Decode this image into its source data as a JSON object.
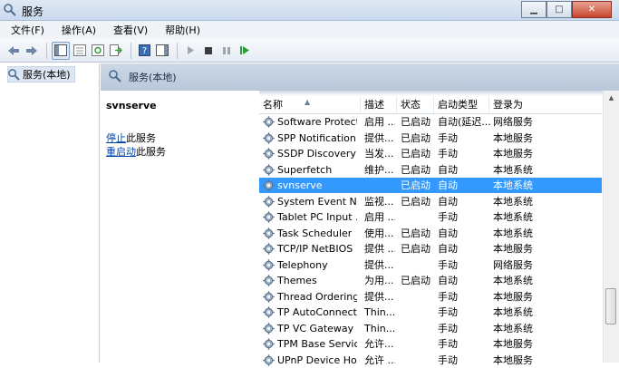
{
  "window": {
    "title": "服务"
  },
  "window_controls": {
    "minimize": "▁",
    "maximize": "□",
    "close": "✕"
  },
  "menu": [
    "文件(F)",
    "操作(A)",
    "查看(V)",
    "帮助(H)"
  ],
  "tree": {
    "root_label": "服务(本地)"
  },
  "content_header": {
    "title": "服务(本地)"
  },
  "description": {
    "service_name": "svnserve",
    "stop_link": "停止",
    "stop_suffix": "此服务",
    "restart_link": "重启动",
    "restart_suffix": "此服务"
  },
  "columns": {
    "name": "名称",
    "desc": "描述",
    "status": "状态",
    "startup": "启动类型",
    "logon": "登录为"
  },
  "sort_indicator": "▲",
  "services": [
    {
      "name": "Software Protect...",
      "desc": "启用 ...",
      "status": "已启动",
      "startup": "自动(延迟...",
      "logon": "网络服务"
    },
    {
      "name": "SPP Notification ...",
      "desc": "提供...",
      "status": "已启动",
      "startup": "手动",
      "logon": "本地服务"
    },
    {
      "name": "SSDP Discovery",
      "desc": "当发...",
      "status": "已启动",
      "startup": "手动",
      "logon": "本地服务"
    },
    {
      "name": "Superfetch",
      "desc": "维护...",
      "status": "已启动",
      "startup": "自动",
      "logon": "本地系统"
    },
    {
      "name": "svnserve",
      "desc": "",
      "status": "已启动",
      "startup": "自动",
      "logon": "本地系统"
    },
    {
      "name": "System Event N...",
      "desc": "监视...",
      "status": "已启动",
      "startup": "自动",
      "logon": "本地系统"
    },
    {
      "name": "Tablet PC Input ...",
      "desc": "启用 ...",
      "status": "",
      "startup": "手动",
      "logon": "本地系统"
    },
    {
      "name": "Task Scheduler",
      "desc": "使用...",
      "status": "已启动",
      "startup": "自动",
      "logon": "本地系统"
    },
    {
      "name": "TCP/IP NetBIOS ...",
      "desc": "提供 ...",
      "status": "已启动",
      "startup": "自动",
      "logon": "本地服务"
    },
    {
      "name": "Telephony",
      "desc": "提供...",
      "status": "",
      "startup": "手动",
      "logon": "网络服务"
    },
    {
      "name": "Themes",
      "desc": "为用...",
      "status": "已启动",
      "startup": "自动",
      "logon": "本地系统"
    },
    {
      "name": "Thread Ordering...",
      "desc": "提供...",
      "status": "",
      "startup": "手动",
      "logon": "本地服务"
    },
    {
      "name": "TP AutoConnect ...",
      "desc": "Thin...",
      "status": "",
      "startup": "手动",
      "logon": "本地系统"
    },
    {
      "name": "TP VC Gateway ...",
      "desc": "Thin...",
      "status": "",
      "startup": "手动",
      "logon": "本地系统"
    },
    {
      "name": "TPM Base Servic...",
      "desc": "允许...",
      "status": "",
      "startup": "手动",
      "logon": "本地服务"
    },
    {
      "name": "UPnP Device Host",
      "desc": "允许 ...",
      "status": "",
      "startup": "手动",
      "logon": "本地服务"
    }
  ],
  "selected_service": "svnserve",
  "colors": {
    "selection": "#3399ff",
    "link": "#0645ad",
    "header_band": "#c3cfdf"
  },
  "icons": [
    "services-app-icon",
    "back-arrow-icon",
    "forward-arrow-icon",
    "console-tree-icon",
    "properties-icon",
    "refresh-icon",
    "export-list-icon",
    "help-icon",
    "show-hide-pane-icon",
    "start-service-icon",
    "stop-service-icon",
    "pause-service-icon",
    "restart-service-icon",
    "gear-icon"
  ]
}
